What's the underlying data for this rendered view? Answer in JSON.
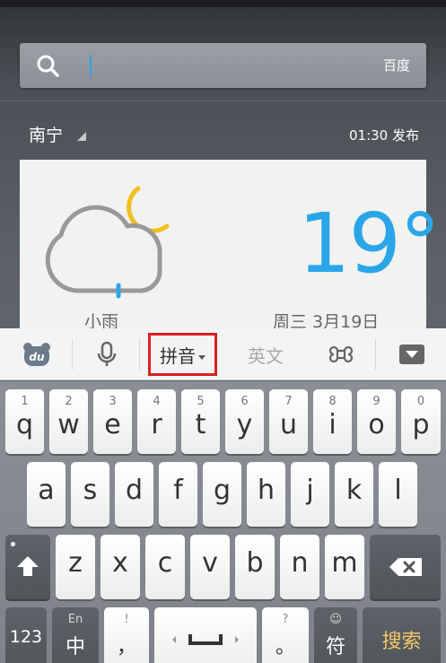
{
  "search": {
    "engine_label": "百度",
    "value": ""
  },
  "location": {
    "city": "南宁",
    "publish_time": "01:30 发布"
  },
  "weather": {
    "description": "小雨",
    "temperature": "19°",
    "date": "周三 3月19日",
    "accent_color": "#2aa6e8"
  },
  "ime_toolbar": {
    "logo_text": "du",
    "pinyin_label": "拼音",
    "english_label": "英文",
    "highlight_color": "#d9201f"
  },
  "keyboard": {
    "row1": [
      {
        "num": "1",
        "letter": "q"
      },
      {
        "num": "2",
        "letter": "w"
      },
      {
        "num": "3",
        "letter": "e"
      },
      {
        "num": "4",
        "letter": "r"
      },
      {
        "num": "5",
        "letter": "t"
      },
      {
        "num": "6",
        "letter": "y"
      },
      {
        "num": "7",
        "letter": "u"
      },
      {
        "num": "8",
        "letter": "i"
      },
      {
        "num": "9",
        "letter": "o"
      },
      {
        "num": "0",
        "letter": "p"
      }
    ],
    "row2": [
      "a",
      "s",
      "d",
      "f",
      "g",
      "h",
      "j",
      "k",
      "l"
    ],
    "row3": [
      "z",
      "x",
      "c",
      "v",
      "b",
      "n",
      "m"
    ],
    "bottom": {
      "numbers_label": "123",
      "lang_top": "En",
      "lang_bottom": "中",
      "punct_top": "!",
      "punct_bottom": "，",
      "punct2_top": "?",
      "punct2_bottom": "。",
      "symbol_top": "☺",
      "symbol_bottom": "符",
      "search_label": "搜索"
    }
  }
}
